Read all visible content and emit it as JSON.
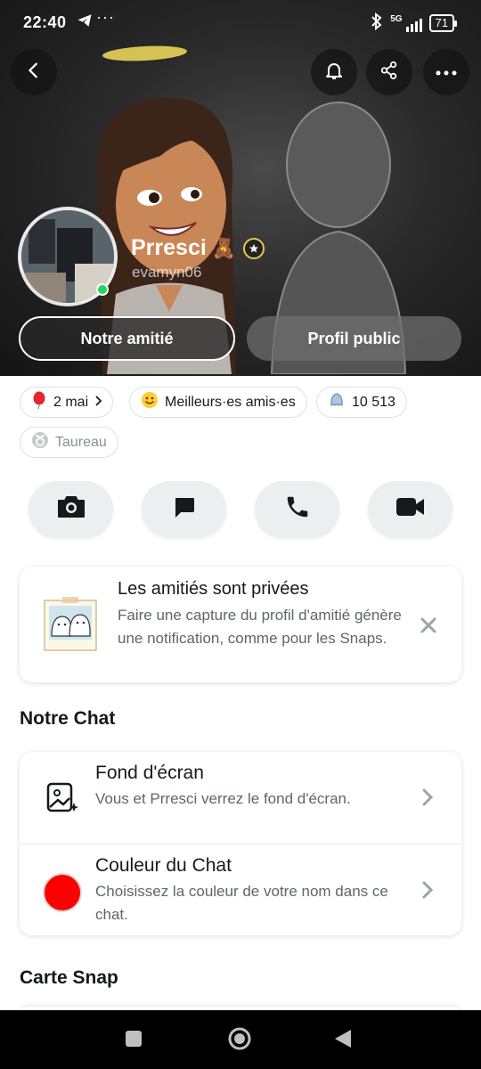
{
  "status_bar": {
    "time": "22:40",
    "more": "···",
    "network": "5G",
    "battery": "71"
  },
  "header": {
    "display_name": "Prresci",
    "name_emoji": "🧸",
    "username": "evamyn06",
    "friendship_button": "Notre amitié",
    "public_profile_button": "Profil public"
  },
  "chips": {
    "birthday": "2 mai",
    "best_friends": "Meilleurs·es amis·es",
    "snapscore": "10 513",
    "zodiac": "Taureau"
  },
  "privacy_card": {
    "title": "Les amitiés sont privées",
    "description": "Faire une capture du profil d'amitié génère une notification, comme pour les Snaps."
  },
  "chat_section": {
    "title": "Notre Chat",
    "wallpaper_title": "Fond d'écran",
    "wallpaper_desc": "Vous et Prresci verrez le fond d'écran.",
    "color_title": "Couleur du Chat",
    "color_desc": "Choisissez la couleur de votre nom dans ce chat.",
    "chat_color": "#ff0000"
  },
  "map_section": {
    "title": "Carte Snap"
  },
  "colors": {
    "online": "#1ed760",
    "star_badge_ring": "#e9c84a"
  }
}
